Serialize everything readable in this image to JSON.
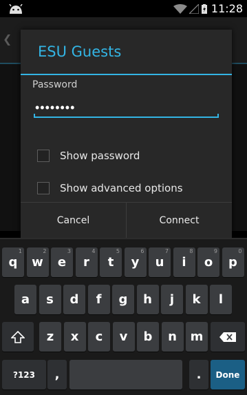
{
  "status_bar": {
    "time": "11:28"
  },
  "dialog": {
    "title": "ESU Guests",
    "password_label": "Password",
    "password_value": "••••••••",
    "show_password_label": "Show password",
    "advanced_label": "Show advanced options",
    "cancel_label": "Cancel",
    "connect_label": "Connect"
  },
  "keyboard": {
    "row1": [
      {
        "k": "q",
        "hint": "1"
      },
      {
        "k": "w",
        "hint": "2"
      },
      {
        "k": "e",
        "hint": "3"
      },
      {
        "k": "r",
        "hint": "4"
      },
      {
        "k": "t",
        "hint": "5"
      },
      {
        "k": "y",
        "hint": "6"
      },
      {
        "k": "u",
        "hint": "7"
      },
      {
        "k": "i",
        "hint": "8"
      },
      {
        "k": "o",
        "hint": "9"
      },
      {
        "k": "p",
        "hint": "0"
      }
    ],
    "row2": [
      "a",
      "s",
      "d",
      "f",
      "g",
      "h",
      "j",
      "k",
      "l"
    ],
    "row3": [
      "z",
      "x",
      "c",
      "v",
      "b",
      "n",
      "m"
    ],
    "symbols_label": "?123",
    "comma_label": ",",
    "period_label": ".",
    "done_label": "Done"
  },
  "colors": {
    "accent": "#33b5e5",
    "done_key": "#1b5f85"
  }
}
